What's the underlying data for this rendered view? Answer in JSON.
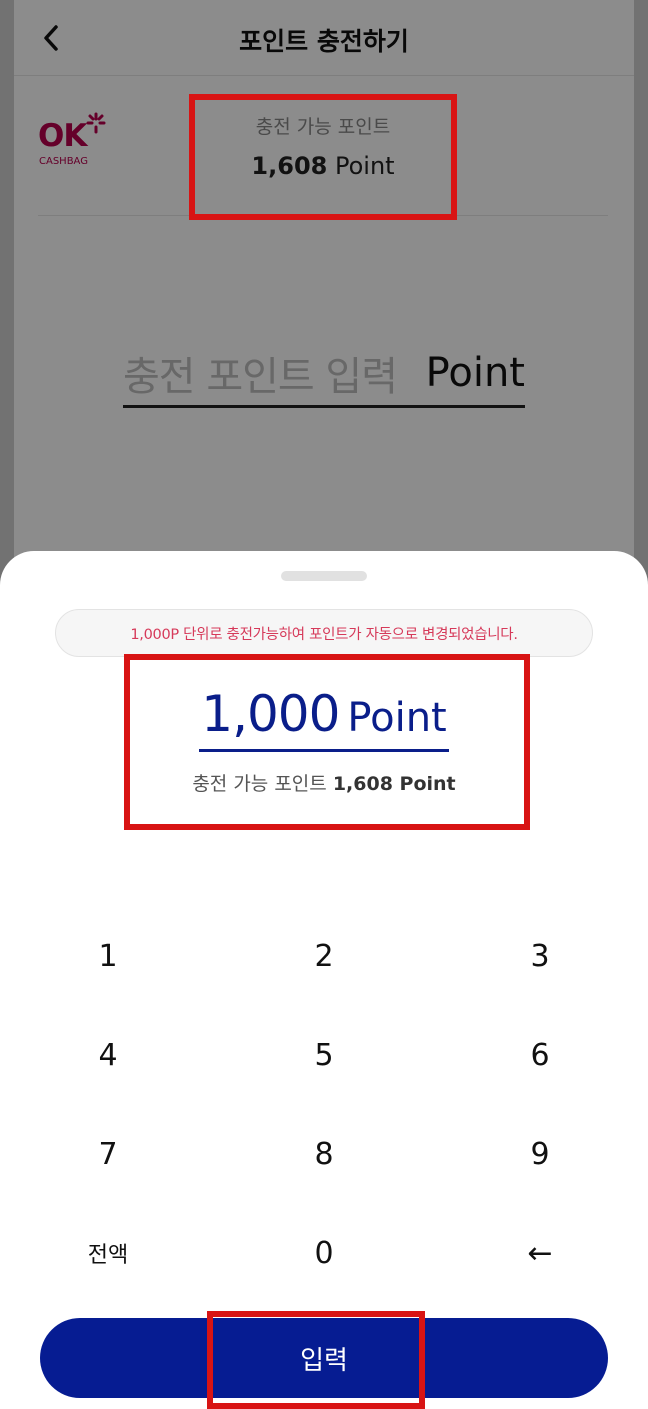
{
  "header": {
    "title": "포인트 충전하기",
    "back_icon": "chevron-left-icon"
  },
  "point_info": {
    "logo_text": "OK",
    "logo_sub": "CASHBAG",
    "available_label": "충전 가능 포인트",
    "available_value": "1,608",
    "available_unit": "Point"
  },
  "charge_input": {
    "placeholder": "충전 포인트 입력",
    "unit": "Point"
  },
  "sheet": {
    "notice": "1,000P 단위로 충전가능하여 포인트가 자동으로 변경되었습니다.",
    "amount": "1,000",
    "amount_unit": "Point",
    "available_label": "충전 가능 포인트",
    "available_value": "1,608 Point"
  },
  "keypad": {
    "keys": [
      "1",
      "2",
      "3",
      "4",
      "5",
      "6",
      "7",
      "8",
      "9",
      "전액",
      "0",
      "←"
    ]
  },
  "submit": {
    "label": "입력"
  },
  "colors": {
    "brand_navy": "#061c92",
    "ok_brand": "#b8004d",
    "highlight_red": "#d81414",
    "notice_text": "#d63a5a"
  }
}
